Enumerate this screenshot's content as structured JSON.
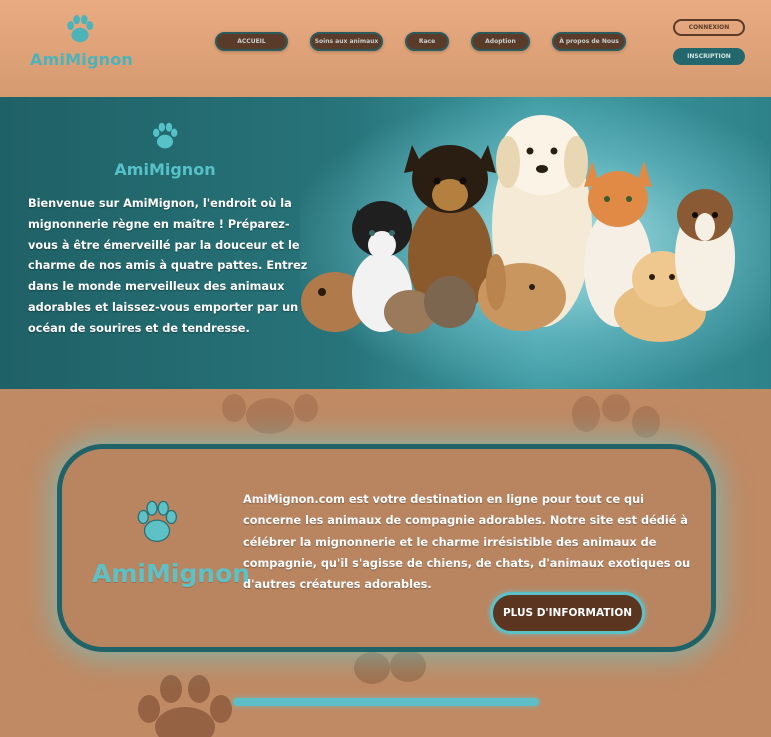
{
  "header": {
    "brand": "AmiMignon",
    "nav": [
      {
        "label": "ACCUEIL"
      },
      {
        "label": "Soins aux animaux"
      },
      {
        "label": "Race"
      },
      {
        "label": "Adoption"
      },
      {
        "label": "À propos de Nous"
      }
    ],
    "login_label": "CONNEXION",
    "signup_label": "INSCRIPTION"
  },
  "hero": {
    "brand": "AmiMignon",
    "text": "Bienvenue sur AmiMignon, l'endroit où la mignonnerie règne en maître ! Préparez-vous à être émerveillé par la douceur et le charme de nos amis à quatre pattes. Entrez dans le monde merveilleux des animaux adorables et laissez-vous emporter par un océan de sourires et de tendresse."
  },
  "card": {
    "brand": "AmiMignon",
    "text": "AmiMignon.com est votre destination en ligne pour tout ce qui concerne les animaux de compagnie adorables. Notre site est dédié à célébrer la mignonnerie et le charme irrésistible des animaux de compagnie, qu'il s'agisse de chiens, de chats, d'animaux exotiques ou d'autres créatures adorables.",
    "button_label": "PLUS D'INFORMATION"
  },
  "colors": {
    "header_bg": "#e9ab82",
    "hero_bg": "#27747a",
    "accent_teal": "#5cbec6",
    "button_brown": "#5c3520",
    "page_bg": "#c08a64"
  },
  "icons": [
    "paw-icon",
    "paw-print-decoration"
  ]
}
